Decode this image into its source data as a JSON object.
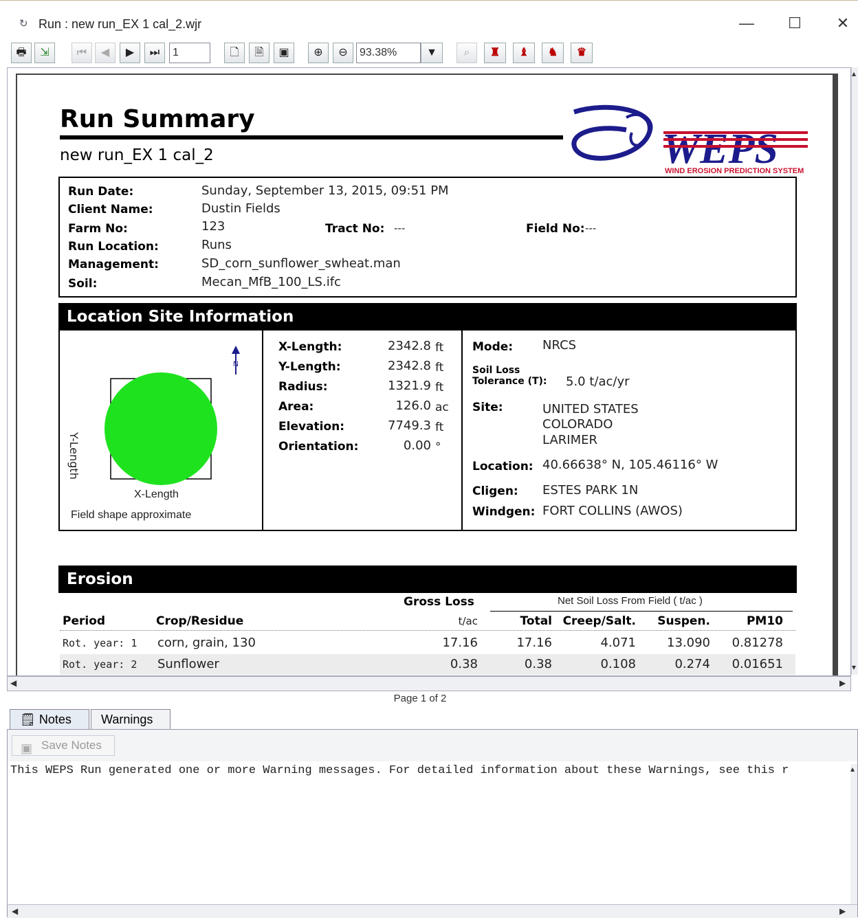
{
  "window": {
    "title": "Run : new run_EX 1 cal_2.wjr",
    "minimize": "—",
    "maximize": "☐",
    "close": "✕"
  },
  "toolbar": {
    "page_input": "1",
    "zoom": "93.38%",
    "icons": [
      "print-icon",
      "export-icon",
      "first-page-icon",
      "prev-page-icon",
      "next-page-icon",
      "last-page-icon",
      "actual-size-icon",
      "fit-width-icon",
      "fit-page-icon",
      "zoom-in-icon",
      "zoom-out-icon",
      "zoom-dropdown-icon",
      "find-icon",
      "find-next-icon",
      "find-prev-icon",
      "find-case-icon",
      "find-whole-icon"
    ]
  },
  "report": {
    "title": "Run Summary",
    "subtitle": "new run_EX 1 cal_2",
    "logo_text": "WEPS",
    "logo_subtext": "WIND EROSION PREDICTION SYSTEM",
    "run_date_label": "Run Date:",
    "run_date": "Sunday, September 13, 2015, 09:51 PM",
    "client_label": "Client Name:",
    "client": "Dustin Fields",
    "farm_label": "Farm No:",
    "farm": "123",
    "tract_label": "Tract No:",
    "tract": "---",
    "field_label": "Field No:",
    "field": "---",
    "location_label": "Run Location:",
    "location": "Runs",
    "management_label": "Management:",
    "management": "SD_corn_sunflower_swheat.man",
    "soil_label": "Soil:",
    "soil": "Mecan_MfB_100_LS.ifc"
  },
  "site": {
    "header": "Location Site Information",
    "y_length_axis": "Y-Length",
    "x_length_axis": "X-Length",
    "north": "N",
    "shape_note": "Field shape approximate",
    "props": [
      {
        "label": "X-Length:",
        "value": "2342.8",
        "unit": "ft"
      },
      {
        "label": "Y-Length:",
        "value": "2342.8",
        "unit": "ft"
      },
      {
        "label": "Radius:",
        "value": "1321.9",
        "unit": "ft"
      },
      {
        "label": "Area:",
        "value": "126.0",
        "unit": "ac"
      },
      {
        "label": "Elevation:",
        "value": "7749.3",
        "unit": "ft"
      },
      {
        "label": "Orientation:",
        "value": "0.00",
        "unit": "°"
      }
    ],
    "mode_label": "Mode:",
    "mode": "NRCS",
    "tolerance_label_1": "Soil Loss",
    "tolerance_label_2": "Tolerance (T):",
    "tolerance": "5.0 t/ac/yr",
    "site_label": "Site:",
    "site_lines": [
      "UNITED STATES",
      "COLORADO",
      "LARIMER"
    ],
    "loc_label": "Location:",
    "loc": "40.66638° N, 105.46116° W",
    "cligen_label": "Cligen:",
    "cligen": "ESTES PARK 1N",
    "windgen_label": "Windgen:",
    "windgen": "FORT COLLINS (AWOS)"
  },
  "erosion": {
    "header": "Erosion",
    "gross_loss": "Gross Loss",
    "net_loss": "Net Soil Loss From Field ( t/ac )",
    "cols": [
      "Period",
      "Crop/Residue",
      "t/ac",
      "Total",
      "Creep/Salt.",
      "Suspen.",
      "PM10"
    ],
    "rows": [
      {
        "period": "Rot. year: 1",
        "crop": "corn, grain, 130",
        "gross": "17.16",
        "total": "17.16",
        "creep": "4.071",
        "suspen": "13.090",
        "pm10": "0.81278"
      },
      {
        "period": "Rot. year: 2",
        "crop": "Sunflower",
        "gross": "0.38",
        "total": "0.38",
        "creep": "0.108",
        "suspen": "0.274",
        "pm10": "0.01651"
      }
    ]
  },
  "status": {
    "page": "Page 1 of 2"
  },
  "tabs": {
    "notes": "Notes",
    "warnings": "Warnings"
  },
  "notes": {
    "save": "Save Notes",
    "text": "This WEPS Run generated one or more Warning messages. For detailed information about these Warnings, see this r"
  },
  "colors": {
    "field": "#1fe21f",
    "logo_blue": "#1c1c8c",
    "logo_red": "#c8102e"
  }
}
